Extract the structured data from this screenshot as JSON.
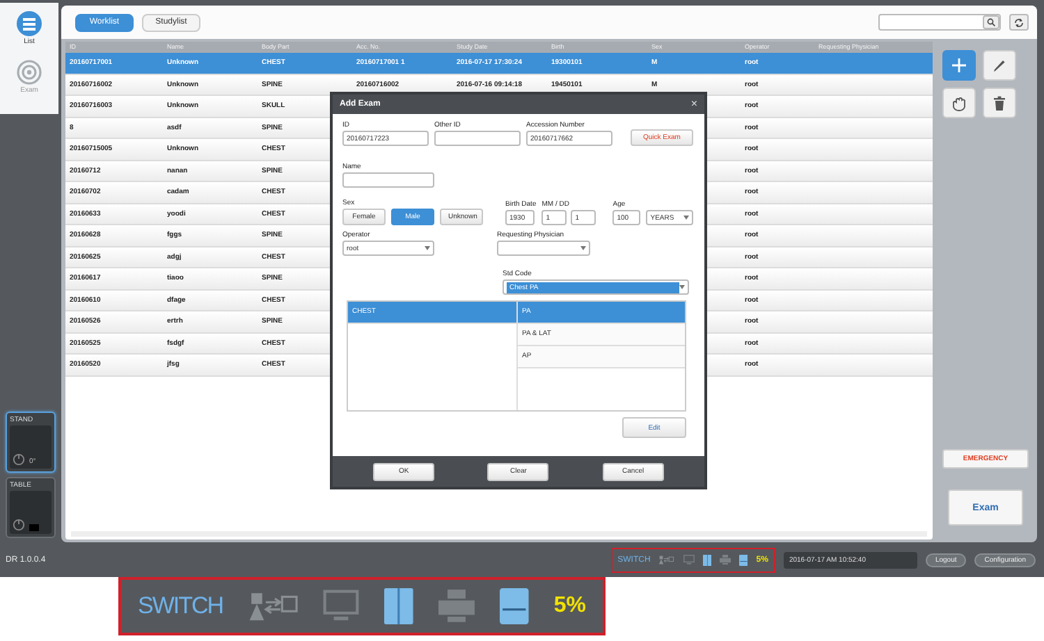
{
  "sidebar": {
    "items": [
      {
        "kind": "list",
        "label": "List",
        "selected": true
      },
      {
        "kind": "exam",
        "label": "Exam",
        "selected": false
      }
    ]
  },
  "devices": [
    {
      "label": "STAND",
      "selected": true,
      "value": "0°"
    },
    {
      "label": "TABLE",
      "selected": false
    }
  ],
  "version": "DR 1.0.0.4",
  "top_tabs": [
    {
      "label": "Worklist",
      "selected": true
    },
    {
      "label": "Studylist",
      "selected": false
    }
  ],
  "table": {
    "columns": [
      "ID",
      "Name",
      "Body Part",
      "Acc. No.",
      "Study Date",
      "Birth",
      "Sex",
      "Operator",
      "Requesting Physician"
    ],
    "rows": [
      {
        "selected": true,
        "cells": [
          "20160717001",
          "Unknown",
          "CHEST",
          "20160717001 1",
          "2016-07-17 17:30:24",
          "19300101",
          "M"
        ],
        "operator": "root"
      },
      {
        "selected": false,
        "cells": [
          "20160716002",
          "Unknown",
          "SPINE",
          "20160716002",
          "2016-07-16 09:14:18",
          "19450101",
          "M"
        ],
        "operator": "root"
      },
      {
        "selected": false,
        "cells": [
          "20160716003",
          "Unknown",
          "SKULL"
        ],
        "operator": "root"
      },
      {
        "selected": false,
        "cells": [
          "8",
          "asdf",
          "SPINE"
        ],
        "operator": "root"
      },
      {
        "selected": false,
        "cells": [
          "20160715005",
          "Unknown",
          "CHEST"
        ],
        "operator": "root"
      },
      {
        "selected": false,
        "cells": [
          "20160712",
          "nanan",
          "SPINE"
        ],
        "operator": "root"
      },
      {
        "selected": false,
        "cells": [
          "20160702",
          "cadam",
          "CHEST"
        ],
        "operator": "root"
      },
      {
        "selected": false,
        "cells": [
          "20160633",
          "yoodi",
          "CHEST"
        ],
        "operator": "root"
      },
      {
        "selected": false,
        "cells": [
          "20160628",
          "fggs",
          "SPINE"
        ],
        "operator": "root"
      },
      {
        "selected": false,
        "cells": [
          "20160625",
          "adgj",
          "CHEST"
        ],
        "operator": "root"
      },
      {
        "selected": false,
        "cells": [
          "20160617",
          "tiaoo",
          "SPINE"
        ],
        "operator": "root"
      },
      {
        "selected": false,
        "cells": [
          "20160610",
          "dfage",
          "CHEST"
        ],
        "operator": "root"
      },
      {
        "selected": false,
        "cells": [
          "20160526",
          "ertrh",
          "SPINE"
        ],
        "operator": "root"
      },
      {
        "selected": false,
        "cells": [
          "20160525",
          "fsdgf",
          "CHEST"
        ],
        "operator": "root"
      },
      {
        "selected": false,
        "cells": [
          "20160520",
          "jfsg",
          "CHEST"
        ],
        "operator": "root"
      }
    ]
  },
  "tools": [
    {
      "kind": "add",
      "selected": true
    },
    {
      "kind": "edit",
      "selected": false
    },
    {
      "kind": "hand",
      "selected": false
    },
    {
      "kind": "delete",
      "selected": false
    }
  ],
  "emergency_button": "EMERGENCY",
  "exam_button": "Exam",
  "dialog": {
    "title": "Add Exam",
    "close": "×",
    "id": {
      "label": "ID",
      "value": "20160717223"
    },
    "other_id": {
      "label": "Other ID"
    },
    "accession": {
      "label": "Accession Number",
      "value": "20160717662"
    },
    "quick_button": "Quick Exam",
    "name": {
      "label": "Name"
    },
    "sex": {
      "label": "Sex",
      "options": [
        {
          "label": "Female",
          "selected": false
        },
        {
          "label": "Male",
          "selected": true
        },
        {
          "label": "Unknown",
          "selected": false
        }
      ]
    },
    "birth_date": {
      "label": "Birth Date",
      "value": "1930"
    },
    "month_day": {
      "label": "MM / DD",
      "values": [
        "1",
        "1"
      ]
    },
    "age": {
      "label": "Age",
      "value": "100",
      "unit": "YEARS"
    },
    "operator": {
      "label": "Operator",
      "value": "root"
    },
    "physician": {
      "label": "Requesting Physician"
    },
    "std_code": {
      "label": "Std Code",
      "value": "Chest PA"
    },
    "body_parts": [
      {
        "label": "CHEST",
        "selected": true
      }
    ],
    "views": [
      {
        "label": "PA",
        "selected": true
      },
      {
        "label": "PA & LAT",
        "selected": false
      },
      {
        "label": "AP",
        "selected": false
      }
    ],
    "edit_button": "Edit",
    "footer_buttons": [
      "OK",
      "Clear",
      "Cancel"
    ]
  },
  "status": {
    "switch": "SWITCH",
    "disk": "5%",
    "datetime": "2016-07-17 AM 10:52:40",
    "buttons": [
      "Logout",
      "Configuration"
    ]
  },
  "callout": {
    "switch": "SWITCH",
    "disk": "5%"
  }
}
